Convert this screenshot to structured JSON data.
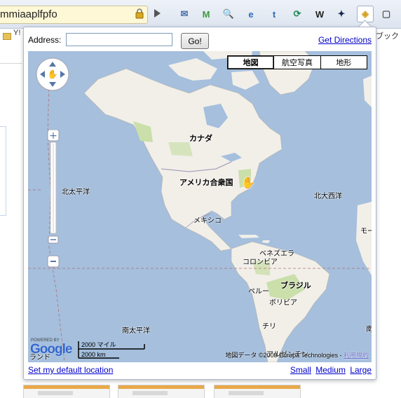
{
  "browser": {
    "url_text": "mmiaaplfpfo",
    "extensions": [
      {
        "icon": "mail-icon",
        "glyph": "✉",
        "color": "#4a6fa8"
      },
      {
        "icon": "gmail-icon",
        "glyph": "M",
        "color": "#3a9a3a"
      },
      {
        "icon": "search-icon",
        "glyph": "🔍",
        "color": "#555"
      },
      {
        "icon": "ie-icon",
        "glyph": "e",
        "color": "#2a6bc4"
      },
      {
        "icon": "tumblr-icon",
        "glyph": "t",
        "color": "#2c6bb8"
      },
      {
        "icon": "sync-icon",
        "glyph": "⟳",
        "color": "#1c8a55"
      },
      {
        "icon": "wikipedia-icon",
        "glyph": "W",
        "color": "#222"
      },
      {
        "icon": "puzzle-icon",
        "glyph": "✦",
        "color": "#1a2a55"
      },
      {
        "icon": "maps-extension-icon",
        "glyph": "◈",
        "color": "#d4a020"
      },
      {
        "icon": "page-menu-icon",
        "glyph": "▢",
        "color": "#555"
      }
    ],
    "bookmark_left": "Y! E",
    "bookmark_right": "ブック"
  },
  "popup": {
    "address_label": "Address:",
    "address_value": "",
    "go_label": "Go!",
    "directions_label": "Get Directions",
    "map_types": [
      "地図",
      "航空写真",
      "地形"
    ],
    "labels": {
      "canada": "カナダ",
      "usa": "アメリカ合衆国",
      "mexico": "メキシコ",
      "north_pacific": "北太平洋",
      "north_atlantic": "北大西洋",
      "venezuela": "ベネズエラ",
      "colombia": "コロンビア",
      "brazil": "ブラジル",
      "peru": "ペルー",
      "bolivia": "ボリビア",
      "chile": "チリ",
      "argentina": "アルゼンチン",
      "south_pacific": "南太平洋",
      "edge_right_mid": "モー",
      "edge_right_low": "南",
      "edge_left_low": "ランド"
    },
    "scale": {
      "miles": "2000 マイル",
      "km": "2000 km"
    },
    "logo": {
      "powered_by": "POWERED BY",
      "name": "Google"
    },
    "attribution": "地図データ ©2009 Europa Technologies - ",
    "terms_label": "利用規約",
    "default_location_label": "Set my default location",
    "sizes": [
      "Small",
      "Medium",
      "Large"
    ]
  }
}
